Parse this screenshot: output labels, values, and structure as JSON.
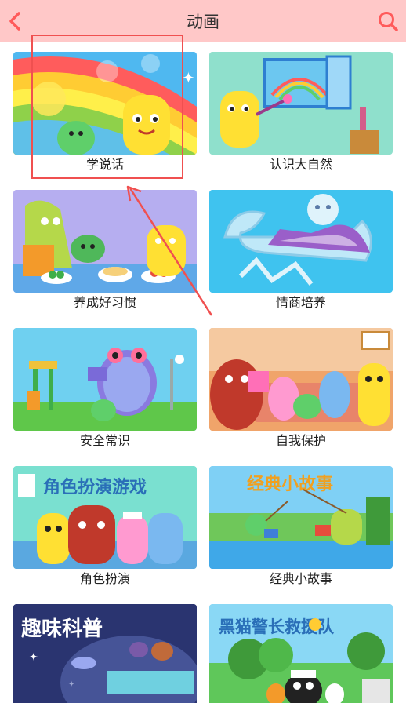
{
  "header": {
    "title": "动画",
    "back_icon": "chevron-left-icon",
    "search_icon": "search-icon",
    "bg_color": "#ffc8c8",
    "icon_color": "#ff5a5a"
  },
  "cards": [
    {
      "label": "学说话"
    },
    {
      "label": "认识大自然"
    },
    {
      "label": "养成好习惯"
    },
    {
      "label": "情商培养"
    },
    {
      "label": "安全常识"
    },
    {
      "label": "自我保护"
    },
    {
      "label": "角色扮演",
      "banner": "角色扮演游戏"
    },
    {
      "label": "经典小故事",
      "banner": "经典小故事"
    },
    {
      "label": "",
      "banner": "趣味科普"
    },
    {
      "label": "",
      "banner": "黑猫警长救援队"
    }
  ],
  "annotation": {
    "color": "#f05050"
  }
}
